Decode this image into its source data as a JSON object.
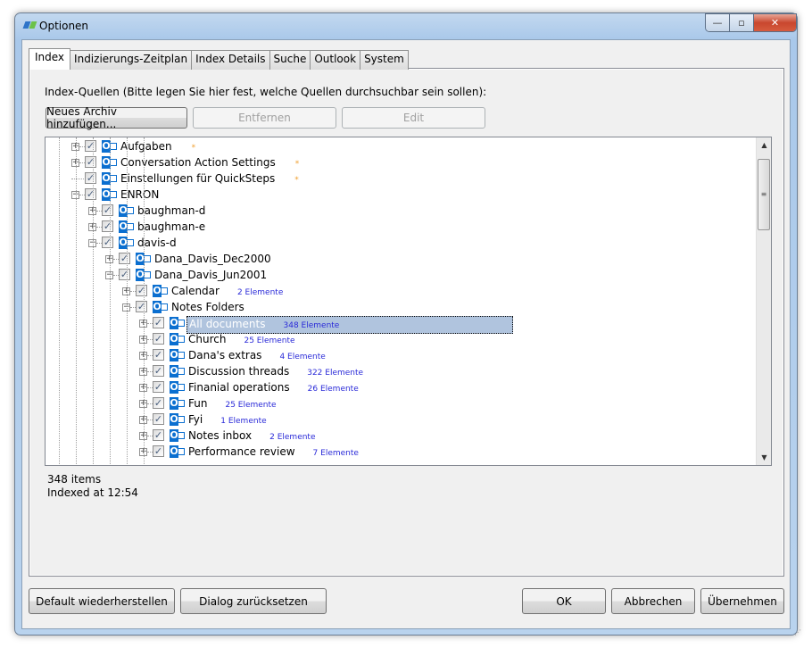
{
  "window": {
    "title": "Optionen",
    "min": "—",
    "max": "▫",
    "close": "✕"
  },
  "tabs": [
    "Index",
    "Indizierungs-Zeitplan",
    "Index Details",
    "Suche",
    "Outlook",
    "System"
  ],
  "index": {
    "label": "Index-Quellen (Bitte legen Sie hier fest, welche Quellen durchsuchbar sein sollen):",
    "add_button": "Neues Archiv hinzufügen...",
    "remove_button": "Entfernen",
    "edit_button": "Edit",
    "tree": [
      {
        "label": "Aufgaben",
        "level": 0,
        "expander": "+",
        "star": "*"
      },
      {
        "label": "Conversation Action Settings",
        "level": 0,
        "expander": "+",
        "star": "*"
      },
      {
        "label": "Einstellungen für QuickSteps",
        "level": 0,
        "expander": "",
        "star": "*"
      },
      {
        "label": "ENRON",
        "level": 0,
        "expander": "-"
      },
      {
        "label": "baughman-d",
        "level": 1,
        "expander": "+"
      },
      {
        "label": "baughman-e",
        "level": 1,
        "expander": "+"
      },
      {
        "label": "davis-d",
        "level": 1,
        "expander": "-"
      },
      {
        "label": "Dana_Davis_Dec2000",
        "level": 2,
        "expander": "+"
      },
      {
        "label": "Dana_Davis_Jun2001",
        "level": 2,
        "expander": "-"
      },
      {
        "label": "Calendar",
        "level": 3,
        "expander": "+",
        "count": "2 Elemente"
      },
      {
        "label": "Notes Folders",
        "level": 3,
        "expander": "-"
      },
      {
        "label": "All documents",
        "level": 4,
        "expander": "+",
        "count": "348 Elemente",
        "selected": true
      },
      {
        "label": "Church",
        "level": 4,
        "expander": "+",
        "count": "25 Elemente"
      },
      {
        "label": "Dana's extras",
        "level": 4,
        "expander": "+",
        "count": "4 Elemente"
      },
      {
        "label": "Discussion threads",
        "level": 4,
        "expander": "+",
        "count": "322 Elemente"
      },
      {
        "label": "Finanial operations",
        "level": 4,
        "expander": "+",
        "count": "26 Elemente"
      },
      {
        "label": "Fun",
        "level": 4,
        "expander": "+",
        "count": "25 Elemente"
      },
      {
        "label": "Fyi",
        "level": 4,
        "expander": "+",
        "count": "1 Elemente"
      },
      {
        "label": "Notes inbox",
        "level": 4,
        "expander": "+",
        "count": "2 Elemente"
      },
      {
        "label": "Performance review",
        "level": 4,
        "expander": "+",
        "count": "7 Elemente"
      }
    ],
    "items_count": "348 items",
    "indexed_at": "Indexed at 12:54"
  },
  "footer": {
    "default": "Default wiederherstellen",
    "reset": "Dialog zurücksetzen",
    "ok": "OK",
    "cancel": "Abbrechen",
    "apply": "Übernehmen"
  }
}
